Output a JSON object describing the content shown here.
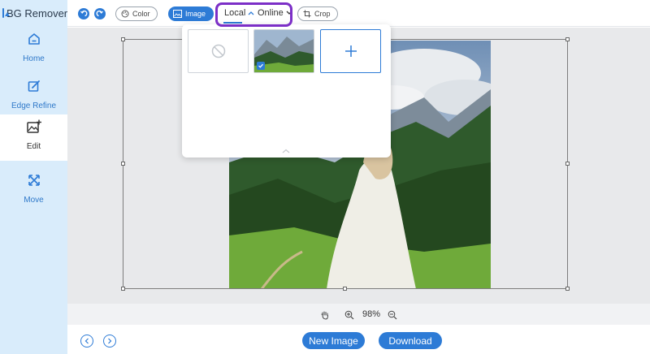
{
  "brand": {
    "title": "BG Remover"
  },
  "sidebar": {
    "items": [
      {
        "label": "Home",
        "icon": "home-icon"
      },
      {
        "label": "Edge Refine",
        "icon": "edit-pen-icon"
      },
      {
        "label": "Edit",
        "icon": "image-edit-icon",
        "active": true
      },
      {
        "label": "Move",
        "icon": "move-arrows-icon"
      }
    ]
  },
  "toolbar": {
    "undo_icon": "undo-icon",
    "redo_icon": "redo-icon",
    "color_label": "Color",
    "image_label": "Image",
    "local_label": "Local",
    "online_label": "Online",
    "crop_label": "Crop"
  },
  "dropdown": {
    "thumbs": [
      {
        "kind": "none",
        "icon": "no-background-icon"
      },
      {
        "kind": "photo",
        "selected": true
      },
      {
        "kind": "add",
        "icon": "plus-icon"
      }
    ]
  },
  "zoom": {
    "value": "98%"
  },
  "bottom": {
    "new_image_label": "New Image",
    "download_label": "Download"
  },
  "colors": {
    "accent": "#2d7bd6",
    "sidebar_bg": "#d9ecfb",
    "highlight": "#7c2fc7",
    "canvas_bg": "#e8e9eb"
  }
}
